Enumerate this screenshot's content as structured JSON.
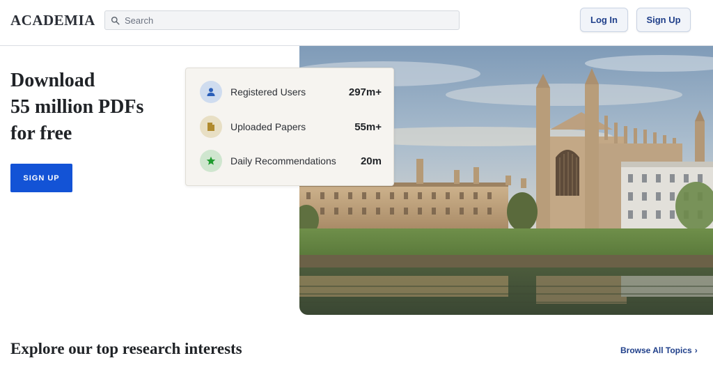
{
  "header": {
    "logo": "ACADEMIA",
    "search_placeholder": "Search",
    "login_label": "Log In",
    "signup_label": "Sign Up"
  },
  "hero": {
    "title_lines": [
      "Download",
      "55 million PDFs",
      "for free"
    ],
    "signup_label": "SIGN UP"
  },
  "stats": [
    {
      "label": "Registered Users",
      "value": "297m+",
      "icon": "user-icon",
      "icon_bg": "#cfdcef",
      "icon_color": "#2b5fb9"
    },
    {
      "label": "Uploaded Papers",
      "value": "55m+",
      "icon": "document-icon",
      "icon_bg": "#e8dfc4",
      "icon_color": "#b08a2e"
    },
    {
      "label": "Daily Recommendations",
      "value": "20m",
      "icon": "star-icon",
      "icon_bg": "#cfe6cf",
      "icon_color": "#1f9b2f"
    }
  ],
  "explore": {
    "title": "Explore our top research interests",
    "browse_label": "Browse All Topics"
  },
  "colors": {
    "brand_blue": "#1353d6",
    "link_blue": "#1f3f8a"
  }
}
